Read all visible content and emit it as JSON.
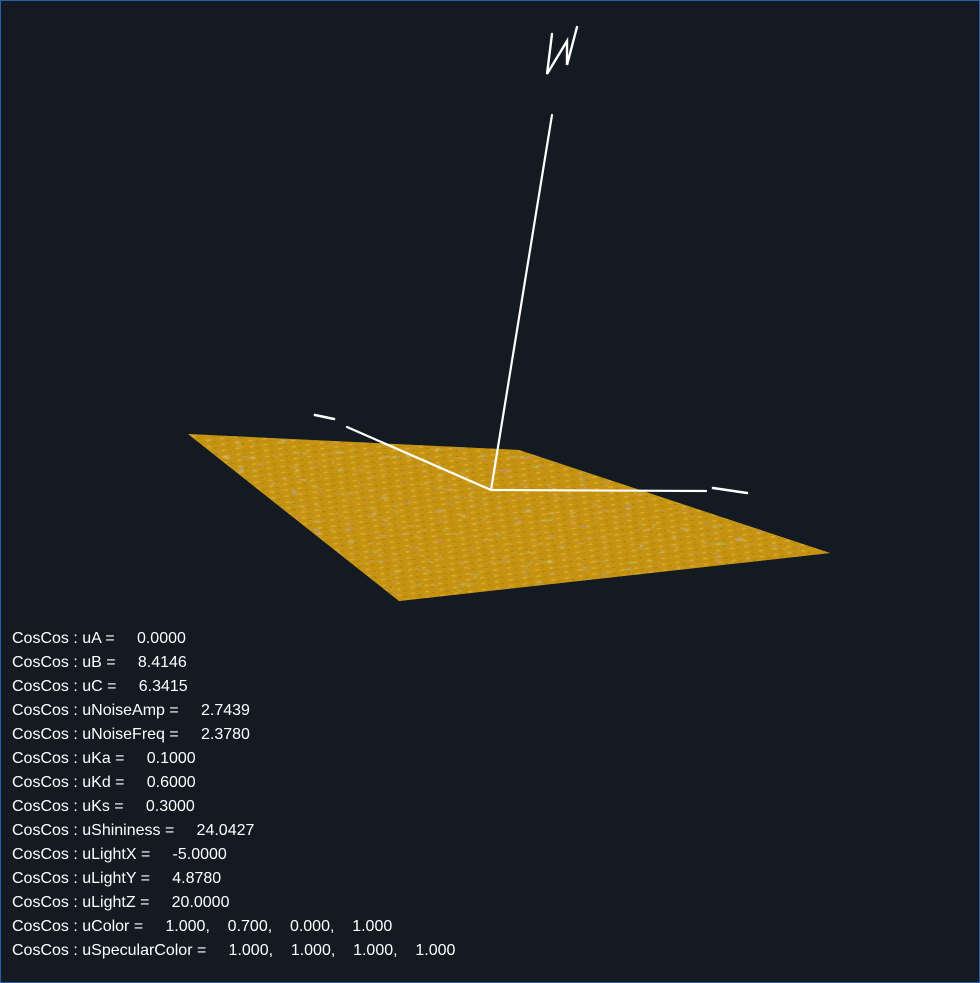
{
  "readouts": [
    {
      "prefix": "CosCos : ",
      "name": "uA",
      "values": [
        "0.0000"
      ]
    },
    {
      "prefix": "CosCos : ",
      "name": "uB",
      "values": [
        "8.4146"
      ]
    },
    {
      "prefix": "CosCos : ",
      "name": "uC",
      "values": [
        "6.3415"
      ]
    },
    {
      "prefix": "CosCos : ",
      "name": "uNoiseAmp",
      "values": [
        "2.7439"
      ]
    },
    {
      "prefix": "CosCos : ",
      "name": "uNoiseFreq",
      "values": [
        "2.3780"
      ]
    },
    {
      "prefix": "CosCos : ",
      "name": "uKa",
      "values": [
        "0.1000"
      ]
    },
    {
      "prefix": "CosCos : ",
      "name": "uKd",
      "values": [
        "0.6000"
      ]
    },
    {
      "prefix": "CosCos : ",
      "name": "uKs",
      "values": [
        "0.3000"
      ]
    },
    {
      "prefix": "CosCos : ",
      "name": "uShininess",
      "values": [
        "24.0427"
      ]
    },
    {
      "prefix": "CosCos : ",
      "name": "uLightX",
      "values": [
        "-5.0000"
      ]
    },
    {
      "prefix": "CosCos : ",
      "name": "uLightY",
      "values": [
        "4.8780"
      ]
    },
    {
      "prefix": "CosCos : ",
      "name": "uLightZ",
      "values": [
        "20.0000"
      ]
    },
    {
      "prefix": "CosCos : ",
      "name": "uColor",
      "values": [
        "1.000,",
        "0.700,",
        "0.000,",
        "1.000"
      ]
    },
    {
      "prefix": "CosCos : ",
      "name": "uSpecularColor",
      "values": [
        "1.000,",
        "1.000,",
        "1.000,",
        "1.000"
      ]
    }
  ],
  "colors": {
    "background": "#131a21",
    "surface": "#c79412",
    "axes": "#ffffff",
    "text": "#ffffff"
  }
}
